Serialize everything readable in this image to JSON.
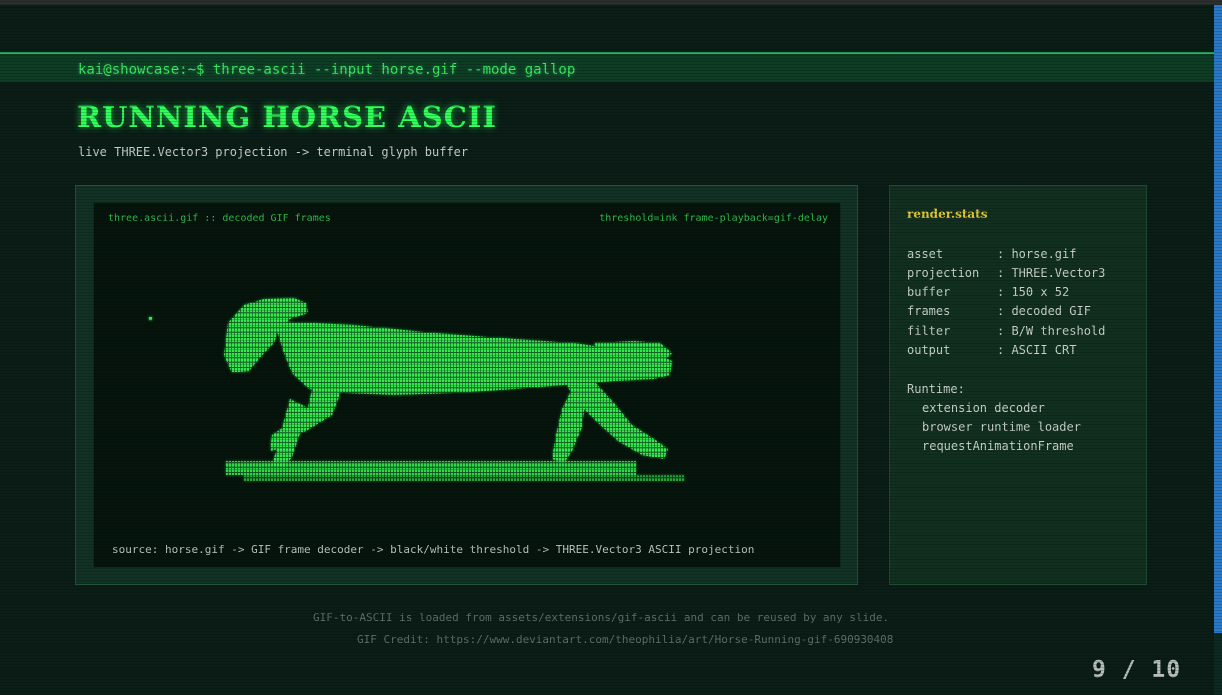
{
  "terminal": {
    "prompt": "kai@showcase:~$ three-ascii --input horse.gif --mode gallop"
  },
  "slide": {
    "title": "RUNNING HORSE ASCII",
    "subtitle": "live THREE.Vector3 projection -> terminal glyph buffer"
  },
  "screen": {
    "label_left": "three.ascii.gif :: decoded GIF frames",
    "label_right": "threshold=ink frame-playback=gif-delay",
    "source": "source: horse.gif -> GIF frame decoder -> black/white threshold -> THREE.Vector3 ASCII projection"
  },
  "stats": {
    "title": "render.stats",
    "rows": [
      {
        "key": "asset",
        "value": ": horse.gif"
      },
      {
        "key": "projection",
        "value": ": THREE.Vector3"
      },
      {
        "key": "buffer",
        "value": ": 150 x 52"
      },
      {
        "key": "frames",
        "value": ": decoded GIF"
      },
      {
        "key": "filter",
        "value": ": B/W threshold"
      },
      {
        "key": "output",
        "value": ": ASCII CRT"
      }
    ],
    "runtime_heading": "Runtime:",
    "runtime": [
      "extension decoder",
      "browser runtime loader",
      "requestAnimationFrame"
    ]
  },
  "footer": {
    "note": "GIF-to-ASCII is loaded from assets/extensions/gif-ascii and can be reused by any slide.",
    "credit": "GIF Credit: https://www.deviantart.com/theophilia/art/Horse-Running-gif-690930408"
  },
  "pager": {
    "text": "9 / 10"
  },
  "colors": {
    "accent": "#31ff5a",
    "stats_title": "#e6c83a",
    "background": "#0b1d17"
  }
}
